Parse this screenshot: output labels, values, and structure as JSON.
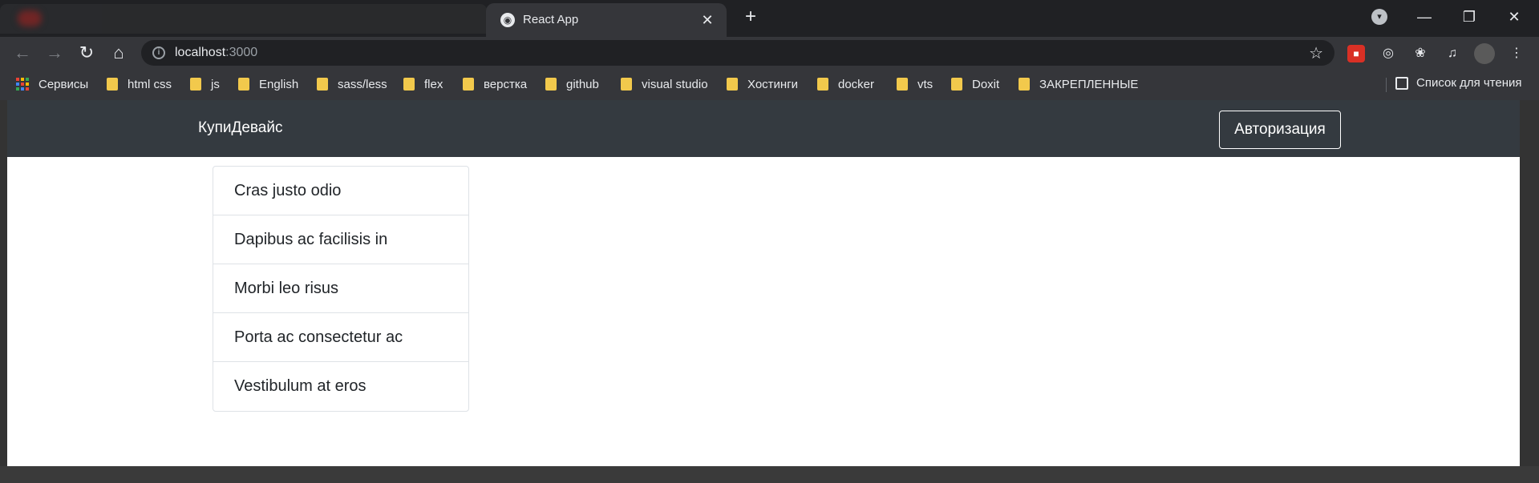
{
  "window": {
    "tab_title": "React App",
    "tab_close_icon": "close-icon",
    "new_tab_icon": "plus-icon",
    "minimize_icon": "minimize-icon",
    "maximize_icon": "restore-icon",
    "close_window_icon": "close-icon"
  },
  "toolbar": {
    "url_host": "localhost",
    "url_port": ":3000"
  },
  "bookmarks": {
    "apps_label": "Сервисы",
    "items": [
      {
        "label": "html css"
      },
      {
        "label": "js"
      },
      {
        "label": "English"
      },
      {
        "label": "sass/less"
      },
      {
        "label": "flex"
      },
      {
        "label": "верстка"
      },
      {
        "label": "github"
      },
      {
        "label": "visual studio"
      },
      {
        "label": "Хостинги"
      },
      {
        "label": "docker"
      },
      {
        "label": "vts"
      },
      {
        "label": "Doxit"
      },
      {
        "label": "ЗАКРЕПЛЕННЫЕ"
      }
    ],
    "reading_list": "Список для чтения"
  },
  "app": {
    "brand": "КупиДевайс",
    "auth_button": "Авторизация",
    "list": [
      "Cras justo odio",
      "Dapibus ac facilisis in",
      "Morbi leo risus",
      "Porta ac consectetur ac",
      "Vestibulum at eros"
    ]
  },
  "colors": {
    "navbar_bg": "#343a40",
    "browser_frame": "#35363a",
    "folder": "#f2c94c"
  }
}
